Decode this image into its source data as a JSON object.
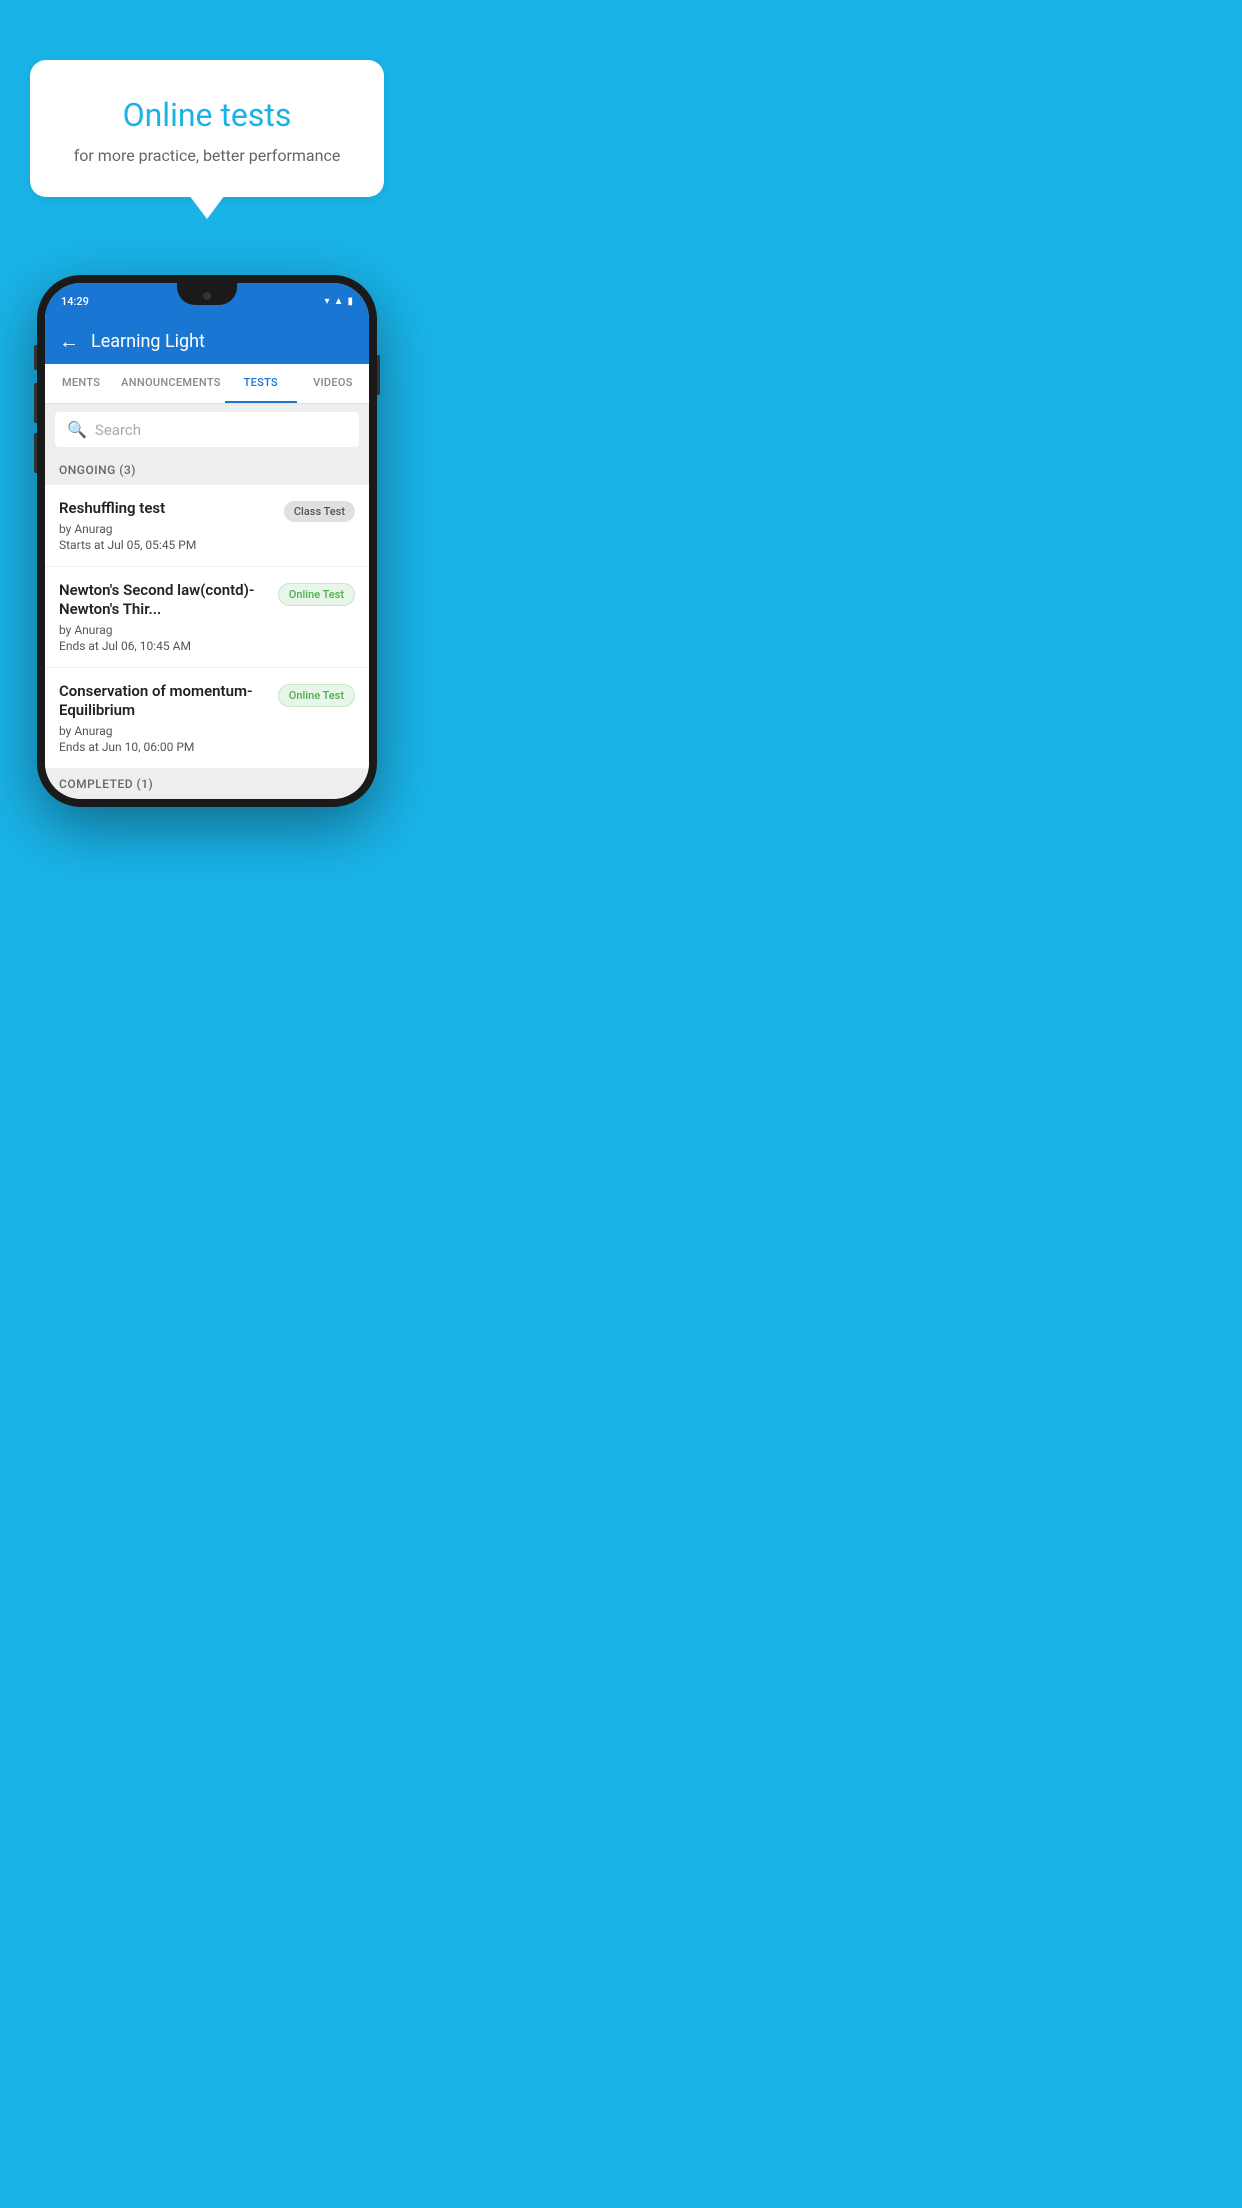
{
  "background_color": "#1ab3e8",
  "hero": {
    "bubble_title": "Online tests",
    "bubble_subtitle": "for more practice, better performance"
  },
  "phone": {
    "status_time": "14:29",
    "app_title": "Learning Light",
    "back_label": "←",
    "tabs": [
      {
        "id": "ments",
        "label": "MENTS",
        "active": false
      },
      {
        "id": "announcements",
        "label": "ANNOUNCEMENTS",
        "active": false
      },
      {
        "id": "tests",
        "label": "TESTS",
        "active": true
      },
      {
        "id": "videos",
        "label": "VIDEOS",
        "active": false
      }
    ],
    "search_placeholder": "Search",
    "ongoing_section_label": "ONGOING (3)",
    "test_items": [
      {
        "name": "Reshuffling test",
        "author": "by Anurag",
        "date_label": "Starts at  Jul 05, 05:45 PM",
        "badge": "Class Test",
        "badge_type": "class"
      },
      {
        "name": "Newton's Second law(contd)-Newton's Thir...",
        "author": "by Anurag",
        "date_label": "Ends at  Jul 06, 10:45 AM",
        "badge": "Online Test",
        "badge_type": "online"
      },
      {
        "name": "Conservation of momentum-Equilibrium",
        "author": "by Anurag",
        "date_label": "Ends at  Jun 10, 06:00 PM",
        "badge": "Online Test",
        "badge_type": "online"
      }
    ],
    "completed_section_label": "COMPLETED (1)"
  }
}
